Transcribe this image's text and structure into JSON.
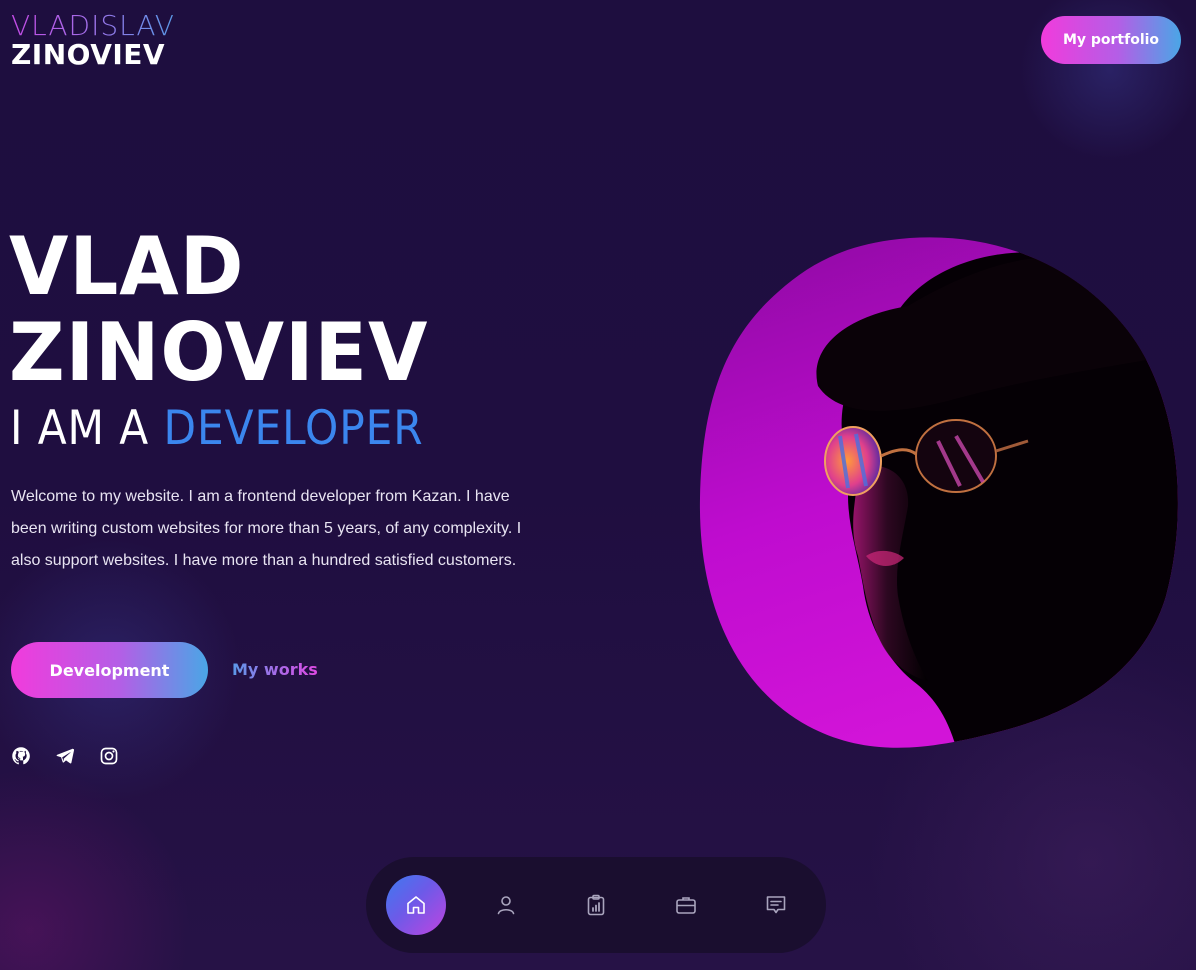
{
  "header": {
    "logo_first": "VLADISLAV",
    "logo_last": "ZINOVIEV",
    "portfolio_button": "My portfolio"
  },
  "hero": {
    "name_line1": "VLAD",
    "name_line2": "ZINOVIEV",
    "role_prefix": "I AM A",
    "role_highlight": "DEVELOPER",
    "description": "Welcome to my website. I am a frontend developer from Kazan. I have been writing custom websites for more than 5 years, of any complexity. I also support websites. I have more than a hundred satisfied customers.",
    "primary_button": "Development",
    "secondary_link": "My works"
  },
  "socials": [
    {
      "icon": "github-icon"
    },
    {
      "icon": "telegram-icon"
    },
    {
      "icon": "instagram-icon"
    }
  ],
  "bottom_nav": {
    "items": [
      {
        "icon": "home-icon",
        "active": true
      },
      {
        "icon": "user-icon",
        "active": false
      },
      {
        "icon": "clipboard-chart-icon",
        "active": false
      },
      {
        "icon": "briefcase-icon",
        "active": false
      },
      {
        "icon": "message-icon",
        "active": false
      }
    ]
  },
  "colors": {
    "background": "#1d0f3d",
    "accent_blue": "#3b86ee",
    "gradient_pink": "#f13bdc",
    "gradient_blue": "#4aa6e6",
    "portrait_magenta": "#c512d6"
  }
}
